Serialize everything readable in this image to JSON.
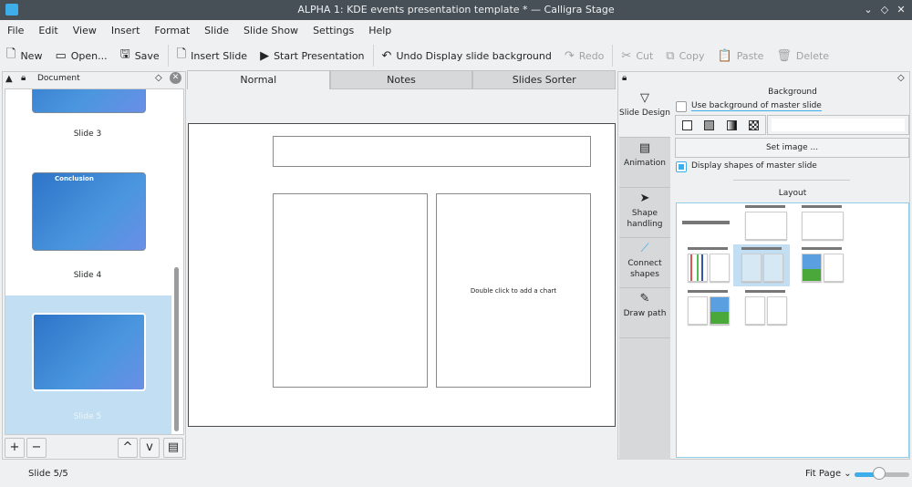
{
  "window": {
    "title": "ALPHA 1: KDE events presentation template * — Calligra Stage"
  },
  "menu": [
    "File",
    "Edit",
    "View",
    "Insert",
    "Format",
    "Slide",
    "Slide Show",
    "Settings",
    "Help"
  ],
  "toolbar": {
    "new": "New",
    "open": "Open...",
    "save": "Save",
    "insert_slide": "Insert Slide",
    "start_presentation": "Start Presentation",
    "undo": "Undo Display slide background",
    "redo": "Redo",
    "cut": "Cut",
    "copy": "Copy",
    "paste": "Paste",
    "delete": "Delete"
  },
  "left_panel": {
    "title": "Document",
    "slides": [
      {
        "label": "Slide 3"
      },
      {
        "label": "Slide 4",
        "thumb_title": "Conclusion"
      },
      {
        "label": "Slide 5",
        "selected": true
      }
    ]
  },
  "view_tabs": [
    "Normal",
    "Notes",
    "Slides Sorter"
  ],
  "slide": {
    "chart_placeholder": "Double click to add a chart"
  },
  "right_panel": {
    "tabs": [
      "Slide Design",
      "Animation",
      "Shape handling",
      "Connect shapes",
      "Draw path"
    ],
    "background_heading": "Background",
    "use_master_bg": "Use background of master slide",
    "use_master_bg_checked": false,
    "set_image": "Set image ...",
    "display_master_shapes": "Display shapes of master slide",
    "display_master_shapes_checked": true,
    "layout_heading": "Layout"
  },
  "status": {
    "slide": "Slide 5/5",
    "zoom": "Fit Page",
    "zoom_slider_fraction": 0.45
  },
  "colors": {
    "accent": "#3daee9",
    "titlebar": "#475057",
    "selection": "#c2def2"
  }
}
